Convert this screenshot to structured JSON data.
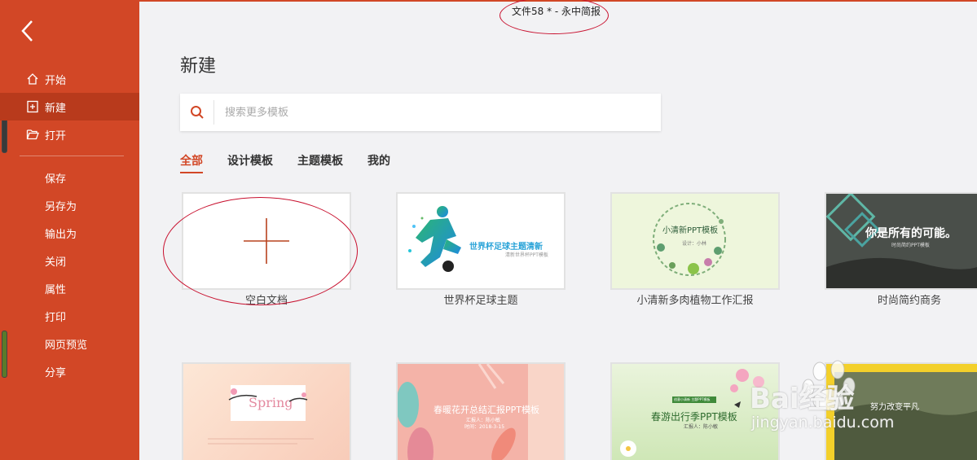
{
  "window": {
    "title": "文件58 *  - 永中简报"
  },
  "sidebar": {
    "nav": [
      {
        "label": "开始",
        "icon": "home-icon"
      },
      {
        "label": "新建",
        "icon": "new-file-icon",
        "active": true
      },
      {
        "label": "打开",
        "icon": "folder-open-icon"
      }
    ],
    "sub": [
      "保存",
      "另存为",
      "输出为",
      "关闭",
      "属性",
      "打印",
      "网页预览",
      "分享"
    ]
  },
  "main": {
    "heading": "新建",
    "search": {
      "placeholder": "搜索更多模板"
    },
    "tabs": [
      "全部",
      "设计模板",
      "主题模板",
      "我的"
    ],
    "templates": [
      {
        "label": "空白文档"
      },
      {
        "label": "世界杯足球主题",
        "thumb_title": "世界杯足球主题清新",
        "thumb_sub": "清新世界杯PPT模板"
      },
      {
        "label": "小清新多肉植物工作汇报",
        "thumb_title": "小清新PPT模板",
        "thumb_sub": "设计：小林"
      },
      {
        "label": "时尚简约商务",
        "thumb_title": "你是所有的可能。",
        "thumb_sub": "时尚简约PPT模板"
      }
    ],
    "templates_row2": [
      {
        "thumb_title": "Spring"
      },
      {
        "thumb_title": "春暖花开总结汇报PPT模板",
        "thumb_sub": "汇报人：陈小敏",
        "thumb_date": "时间：2018-3-15"
      },
      {
        "thumb_title": "春游出行季PPT模板",
        "thumb_sub": "汇报人：陈小敏",
        "thumb_badge": "创意小清新 主题PPT模板"
      },
      {
        "thumb_title": "努力改变平凡"
      }
    ]
  },
  "watermark": {
    "text": "Bai经验",
    "url": "jingyan.baidu.com"
  },
  "colors": {
    "accent": "#d24726",
    "accent_dark": "#b83a1c",
    "annotation": "#c8102e"
  }
}
